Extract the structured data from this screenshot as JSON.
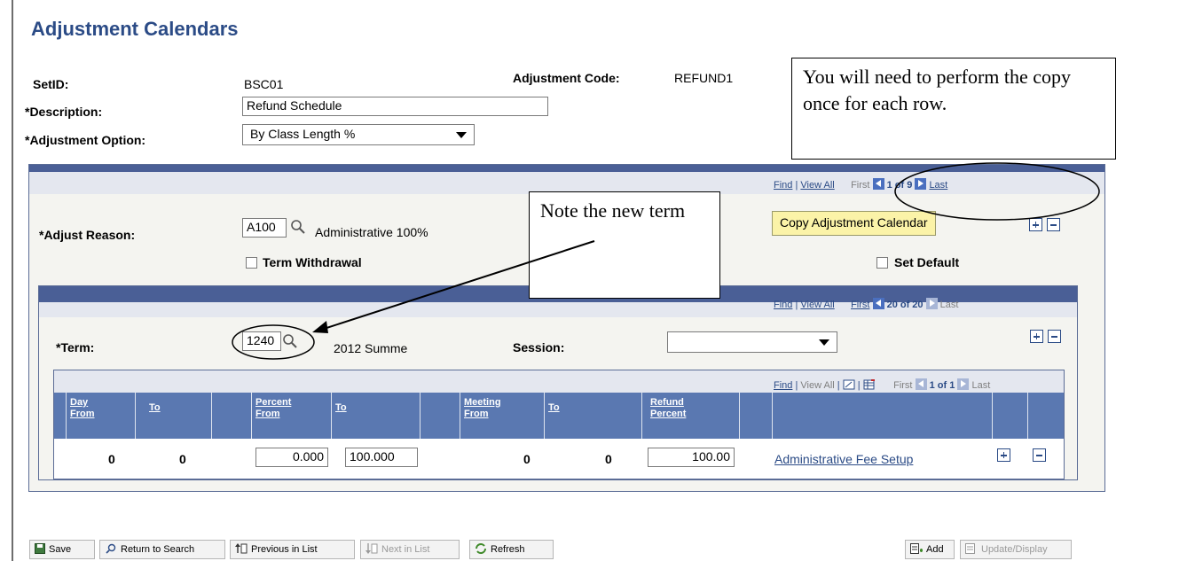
{
  "page": {
    "title": "Adjustment Calendars"
  },
  "header": {
    "setid_label": "SetID:",
    "setid_value": "BSC01",
    "adj_code_label": "Adjustment Code:",
    "adj_code_value": "REFUND1",
    "description_label": "*Description:",
    "description_value": "Refund Schedule",
    "adj_option_label": "*Adjustment Option:",
    "adj_option_value": "By Class Length %"
  },
  "callouts": {
    "copy_note": "You will need to perform the copy once for each row.",
    "term_note": "Note the new term"
  },
  "outer_nav": {
    "find": "Find",
    "view_all": "View All",
    "first": "First",
    "count": "1 of 9",
    "last": "Last"
  },
  "reason": {
    "label": "*Adjust Reason:",
    "value": "A100",
    "description": "Administrative 100%",
    "term_withdrawal_label": "Term Withdrawal",
    "set_default_label": "Set Default",
    "copy_button": "Copy Adjustment Calendar"
  },
  "inner_nav": {
    "find": "Find",
    "view_all": "View All",
    "first": "First",
    "count": "20 of 20",
    "last": "Last"
  },
  "term": {
    "label": "*Term:",
    "value": "1240",
    "description": "2012 Summe",
    "session_label": "Session:",
    "session_value": ""
  },
  "grid_nav": {
    "find": "Find",
    "view_all": "View All",
    "first": "First",
    "count": "1 of 1",
    "last": "Last"
  },
  "grid": {
    "headers": {
      "day_from_1": "Day",
      "day_from_2": "From",
      "to1": "To",
      "percent_from_1": "Percent",
      "percent_from_2": "From",
      "to2": "To",
      "meeting_from_1": "Meeting",
      "meeting_from_2": "From",
      "to3": "To",
      "refund_percent_1": "Refund",
      "refund_percent_2": "Percent"
    },
    "row": {
      "day_from": "0",
      "day_to": "0",
      "percent_from": "0.000",
      "percent_to": "100.000",
      "meeting_from": "0",
      "meeting_to": "0",
      "refund_percent": "100.00",
      "fee_link": "Administrative Fee Setup"
    }
  },
  "toolbar": {
    "save": "Save",
    "return_to_search": "Return to Search",
    "previous_in_list": "Previous in List",
    "next_in_list": "Next in List",
    "refresh": "Refresh",
    "add": "Add",
    "update_display": "Update/Display"
  }
}
